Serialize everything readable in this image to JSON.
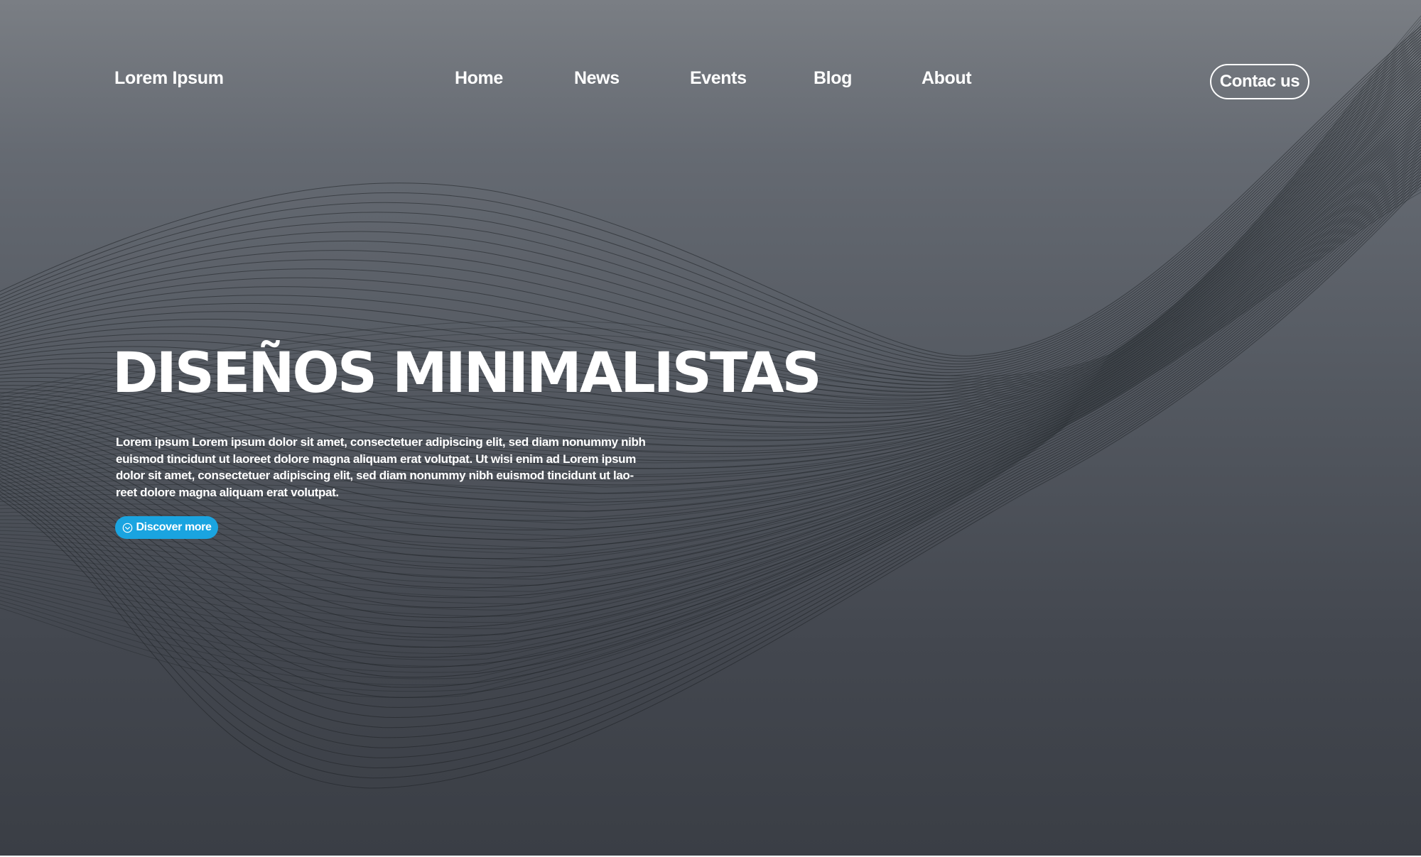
{
  "brand": {
    "logo_text": "Lorem Ipsum"
  },
  "nav": {
    "items": [
      {
        "label": "Home"
      },
      {
        "label": "News"
      },
      {
        "label": "Events"
      },
      {
        "label": "Blog"
      },
      {
        "label": "About"
      }
    ],
    "contact_label": "Contac us"
  },
  "hero": {
    "title": "DISEÑOS MINIMALISTAS",
    "body": "Lorem ipsum Lorem ipsum dolor sit amet, consectetuer adipiscing elit, sed diam nonummy nibh\neuismod tincidunt ut laoreet dolore magna aliquam erat volutpat. Ut wisi enim ad Lorem ipsum\ndolor sit amet, consectetuer adipiscing elit, sed diam nonummy nibh euismod tincidunt ut lao-\nreet dolore magna aliquam erat volutpat.",
    "cta_label": "Discover more",
    "cta_icon": "chevron-down-circle-icon"
  },
  "colors": {
    "accent": "#1aa4e0",
    "background_top": "#7a7e84",
    "background_bottom": "#3a3e45",
    "wave_lines": "#1e2125"
  }
}
